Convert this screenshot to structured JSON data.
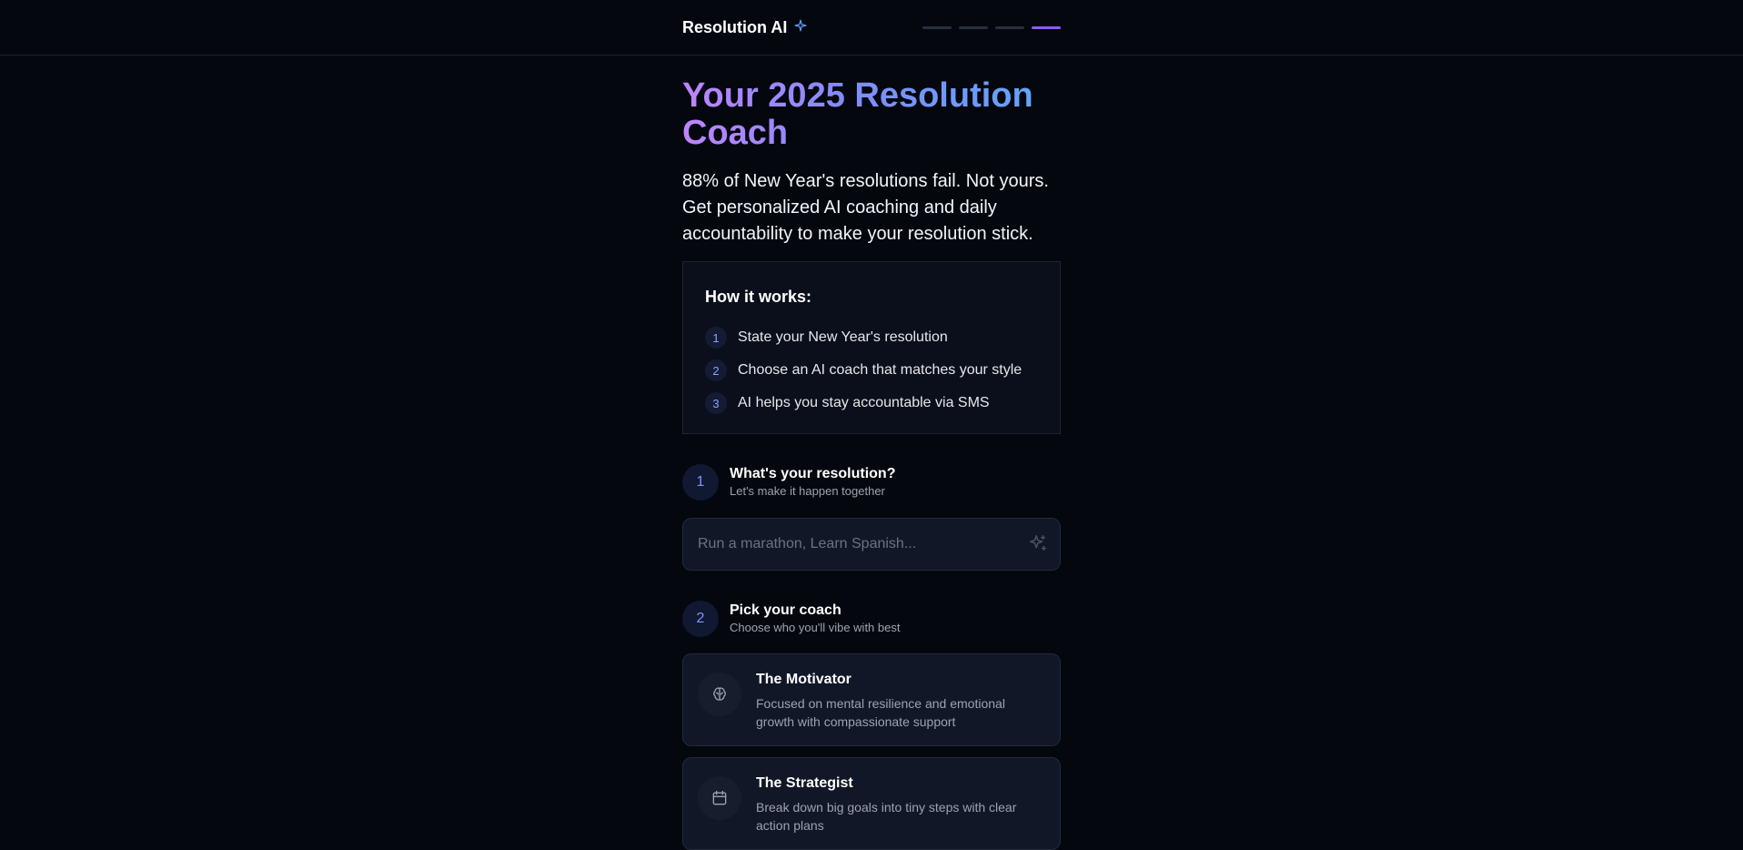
{
  "header": {
    "brand": "Resolution AI",
    "brand_icon": "sparkle-icon",
    "progress_steps": 4,
    "progress_active_index": 3
  },
  "hero": {
    "title": "Your 2025 Resolution Coach",
    "subtitle": "88% of New Year's resolutions fail. Not yours. Get personalized AI coaching and daily accountability to make your resolution stick."
  },
  "how_it_works": {
    "title": "How it works:",
    "steps": [
      {
        "num": "1",
        "text": "State your New Year's resolution"
      },
      {
        "num": "2",
        "text": "Choose an AI coach that matches your style"
      },
      {
        "num": "3",
        "text": "AI helps you stay accountable via SMS"
      }
    ]
  },
  "step1": {
    "num": "1",
    "title": "What's your resolution?",
    "subtitle": "Let's make it happen together",
    "input_placeholder": "Run a marathon, Learn Spanish...",
    "input_value": ""
  },
  "step2": {
    "num": "2",
    "title": "Pick your coach",
    "subtitle": "Choose who you'll vibe with best",
    "coaches": [
      {
        "name": "The Motivator",
        "description": "Focused on mental resilience and emotional growth with compassionate support",
        "icon": "brain-icon"
      },
      {
        "name": "The Strategist",
        "description": "Break down big goals into tiny steps with clear action plans",
        "icon": "calendar-icon"
      }
    ]
  },
  "colors": {
    "background": "#05070f",
    "accent_purple": "#8b5cf6",
    "accent_blue": "#60a5fa",
    "card_bg": "#111726"
  }
}
